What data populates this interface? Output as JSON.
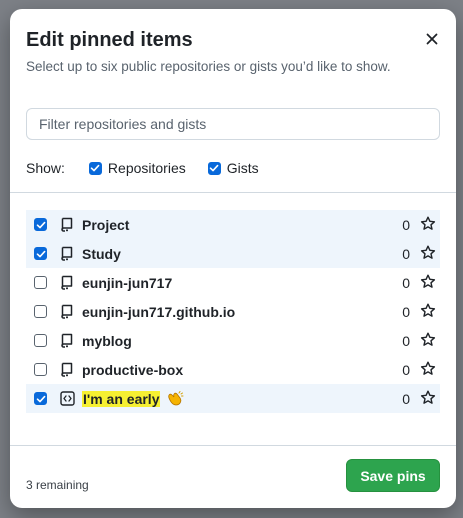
{
  "modal": {
    "title": "Edit pinned items",
    "subtitle": "Select up to six public repositories or gists you’d like to show."
  },
  "filter": {
    "placeholder": "Filter repositories and gists",
    "value": ""
  },
  "show": {
    "label": "Show:",
    "options": [
      {
        "label": "Repositories",
        "checked": true
      },
      {
        "label": "Gists",
        "checked": true
      }
    ]
  },
  "items": [
    {
      "name": "Project",
      "stars": "0",
      "checked": true,
      "type": "repo-icon"
    },
    {
      "name": "Study",
      "stars": "0",
      "checked": true,
      "type": "repo-icon"
    },
    {
      "name": "eunjin-jun717",
      "stars": "0",
      "checked": false,
      "type": "repo-icon"
    },
    {
      "name": "eunjin-jun717.github.io",
      "stars": "0",
      "checked": false,
      "type": "repo-icon"
    },
    {
      "name": "myblog",
      "stars": "0",
      "checked": false,
      "type": "repo-icon"
    },
    {
      "name": "productive-box",
      "stars": "0",
      "checked": false,
      "type": "repo-icon"
    },
    {
      "name": "I'm an early",
      "stars": "0",
      "checked": true,
      "type": "code-square-icon"
    }
  ],
  "footer": {
    "remaining": "3 remaining",
    "save_label": "Save pins"
  },
  "colors": {
    "accent": "#0969da",
    "save_green": "#2da44e",
    "selected_row": "#eef5fc",
    "highlight": "#f6f032"
  }
}
